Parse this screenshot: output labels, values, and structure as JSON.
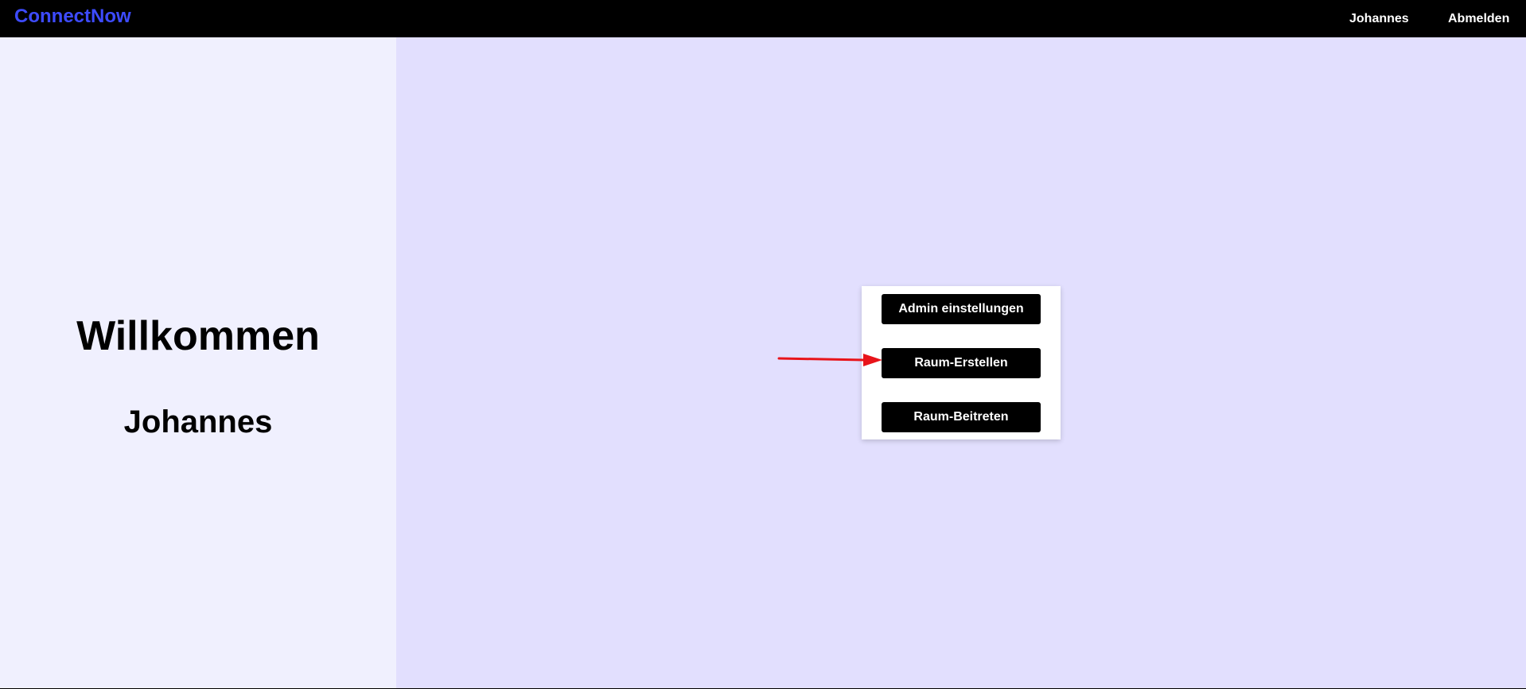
{
  "header": {
    "brand": "ConnectNow",
    "user_name": "Johannes",
    "logout_label": "Abmelden"
  },
  "welcome": {
    "title": "Willkommen",
    "name": "Johannes"
  },
  "menu": {
    "admin_label": "Admin einstellungen",
    "create_room_label": "Raum-Erstellen",
    "join_room_label": "Raum-Beitreten"
  },
  "colors": {
    "brand": "#3d4bff",
    "navbar": "#000000",
    "left_panel": "#f0f0fe",
    "right_panel": "#e2dffe",
    "annotation_arrow": "#e8141a"
  },
  "annotation": {
    "icon": "red-arrow-icon",
    "points_to": "create-room-button"
  }
}
